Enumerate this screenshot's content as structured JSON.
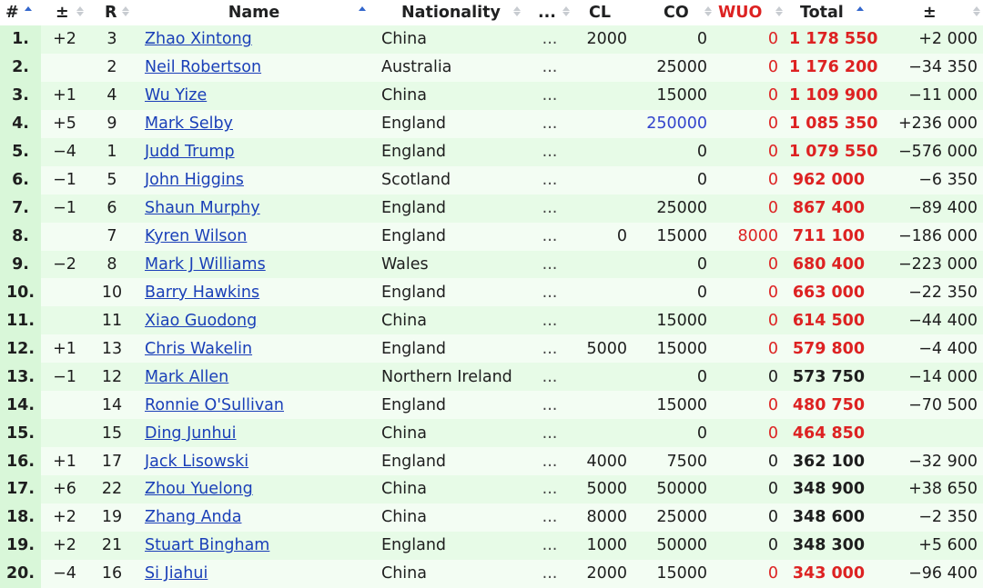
{
  "headers": [
    "#",
    "±",
    "R",
    "Name",
    "Nationality",
    "...",
    "CL",
    "CO",
    "WUO",
    "Total",
    "±"
  ],
  "rows": [
    {
      "rank": "1.",
      "chg": "+2",
      "r": "3",
      "name": "Zhao Xintong",
      "nat": "China",
      "dots": "...",
      "cl": "2000",
      "co": "0",
      "coBlue": false,
      "wuo": "0",
      "wuoRed": true,
      "total": "1 178 550",
      "totalRed": true,
      "diff": "+2 000"
    },
    {
      "rank": "2.",
      "chg": "",
      "r": "2",
      "name": "Neil Robertson",
      "nat": "Australia",
      "dots": "...",
      "cl": "",
      "co": "25000",
      "coBlue": false,
      "wuo": "0",
      "wuoRed": true,
      "total": "1 176 200",
      "totalRed": true,
      "diff": "−34 350"
    },
    {
      "rank": "3.",
      "chg": "+1",
      "r": "4",
      "name": "Wu Yize",
      "nat": "China",
      "dots": "...",
      "cl": "",
      "co": "15000",
      "coBlue": false,
      "wuo": "0",
      "wuoRed": true,
      "total": "1 109 900",
      "totalRed": true,
      "diff": "−11 000"
    },
    {
      "rank": "4.",
      "chg": "+5",
      "r": "9",
      "name": "Mark Selby",
      "nat": "England",
      "dots": "...",
      "cl": "",
      "co": "250000",
      "coBlue": true,
      "wuo": "0",
      "wuoRed": true,
      "total": "1 085 350",
      "totalRed": true,
      "diff": "+236 000"
    },
    {
      "rank": "5.",
      "chg": "−4",
      "r": "1",
      "name": "Judd Trump",
      "nat": "England",
      "dots": "...",
      "cl": "",
      "co": "0",
      "coBlue": false,
      "wuo": "0",
      "wuoRed": true,
      "total": "1 079 550",
      "totalRed": true,
      "diff": "−576 000"
    },
    {
      "rank": "6.",
      "chg": "−1",
      "r": "5",
      "name": "John Higgins",
      "nat": "Scotland",
      "dots": "...",
      "cl": "",
      "co": "0",
      "coBlue": false,
      "wuo": "0",
      "wuoRed": true,
      "total": "962 000",
      "totalRed": true,
      "diff": "−6 350"
    },
    {
      "rank": "7.",
      "chg": "−1",
      "r": "6",
      "name": "Shaun Murphy",
      "nat": "England",
      "dots": "...",
      "cl": "",
      "co": "25000",
      "coBlue": false,
      "wuo": "0",
      "wuoRed": true,
      "total": "867 400",
      "totalRed": true,
      "diff": "−89 400"
    },
    {
      "rank": "8.",
      "chg": "",
      "r": "7",
      "name": "Kyren Wilson",
      "nat": "England",
      "dots": "...",
      "cl": "0",
      "co": "15000",
      "coBlue": false,
      "wuo": "8000",
      "wuoRed": true,
      "total": "711 100",
      "totalRed": true,
      "diff": "−186 000"
    },
    {
      "rank": "9.",
      "chg": "−2",
      "r": "8",
      "name": "Mark J Williams",
      "nat": "Wales",
      "dots": "...",
      "cl": "",
      "co": "0",
      "coBlue": false,
      "wuo": "0",
      "wuoRed": true,
      "total": "680 400",
      "totalRed": true,
      "diff": "−223 000"
    },
    {
      "rank": "10.",
      "chg": "",
      "r": "10",
      "name": "Barry Hawkins",
      "nat": "England",
      "dots": "...",
      "cl": "",
      "co": "0",
      "coBlue": false,
      "wuo": "0",
      "wuoRed": true,
      "total": "663 000",
      "totalRed": true,
      "diff": "−22 350"
    },
    {
      "rank": "11.",
      "chg": "",
      "r": "11",
      "name": "Xiao Guodong",
      "nat": "China",
      "dots": "...",
      "cl": "",
      "co": "15000",
      "coBlue": false,
      "wuo": "0",
      "wuoRed": true,
      "total": "614 500",
      "totalRed": true,
      "diff": "−44 400"
    },
    {
      "rank": "12.",
      "chg": "+1",
      "r": "13",
      "name": "Chris Wakelin",
      "nat": "England",
      "dots": "...",
      "cl": "5000",
      "co": "15000",
      "coBlue": false,
      "wuo": "0",
      "wuoRed": true,
      "total": "579 800",
      "totalRed": true,
      "diff": "−4 400"
    },
    {
      "rank": "13.",
      "chg": "−1",
      "r": "12",
      "name": "Mark Allen",
      "nat": "Northern Ireland",
      "dots": "...",
      "cl": "",
      "co": "0",
      "coBlue": false,
      "wuo": "0",
      "wuoRed": false,
      "total": "573 750",
      "totalRed": false,
      "diff": "−14 000"
    },
    {
      "rank": "14.",
      "chg": "",
      "r": "14",
      "name": "Ronnie O'Sullivan",
      "nat": "England",
      "dots": "...",
      "cl": "",
      "co": "15000",
      "coBlue": false,
      "wuo": "0",
      "wuoRed": true,
      "total": "480 750",
      "totalRed": true,
      "diff": "−70 500"
    },
    {
      "rank": "15.",
      "chg": "",
      "r": "15",
      "name": "Ding Junhui",
      "nat": "China",
      "dots": "...",
      "cl": "",
      "co": "0",
      "coBlue": false,
      "wuo": "0",
      "wuoRed": true,
      "total": "464 850",
      "totalRed": true,
      "diff": ""
    },
    {
      "rank": "16.",
      "chg": "+1",
      "r": "17",
      "name": "Jack Lisowski",
      "nat": "England",
      "dots": "...",
      "cl": "4000",
      "co": "7500",
      "coBlue": false,
      "wuo": "0",
      "wuoRed": false,
      "total": "362 100",
      "totalRed": false,
      "diff": "−32 900"
    },
    {
      "rank": "17.",
      "chg": "+6",
      "r": "22",
      "name": "Zhou Yuelong",
      "nat": "China",
      "dots": "...",
      "cl": "5000",
      "co": "50000",
      "coBlue": false,
      "wuo": "0",
      "wuoRed": false,
      "total": "348 900",
      "totalRed": false,
      "diff": "+38 650"
    },
    {
      "rank": "18.",
      "chg": "+2",
      "r": "19",
      "name": "Zhang Anda",
      "nat": "China",
      "dots": "...",
      "cl": "8000",
      "co": "25000",
      "coBlue": false,
      "wuo": "0",
      "wuoRed": false,
      "total": "348 600",
      "totalRed": false,
      "diff": "−2 350"
    },
    {
      "rank": "19.",
      "chg": "+2",
      "r": "21",
      "name": "Stuart Bingham",
      "nat": "England",
      "dots": "...",
      "cl": "1000",
      "co": "50000",
      "coBlue": false,
      "wuo": "0",
      "wuoRed": false,
      "total": "348 300",
      "totalRed": false,
      "diff": "+5 600"
    },
    {
      "rank": "20.",
      "chg": "−4",
      "r": "16",
      "name": "Si Jiahui",
      "nat": "China",
      "dots": "...",
      "cl": "2000",
      "co": "15000",
      "coBlue": false,
      "wuo": "0",
      "wuoRed": true,
      "total": "343 000",
      "totalRed": true,
      "diff": "−96 400"
    }
  ],
  "colors": {
    "red": "#dd2222",
    "blue": "#3344cc",
    "link": "#1a3fb8",
    "row_odd": "#e7fbe7",
    "row_even": "#f3fdf3"
  },
  "icons": {
    "sort": "sort-arrows-icon",
    "sort_active": "sort-ascending-icon"
  }
}
